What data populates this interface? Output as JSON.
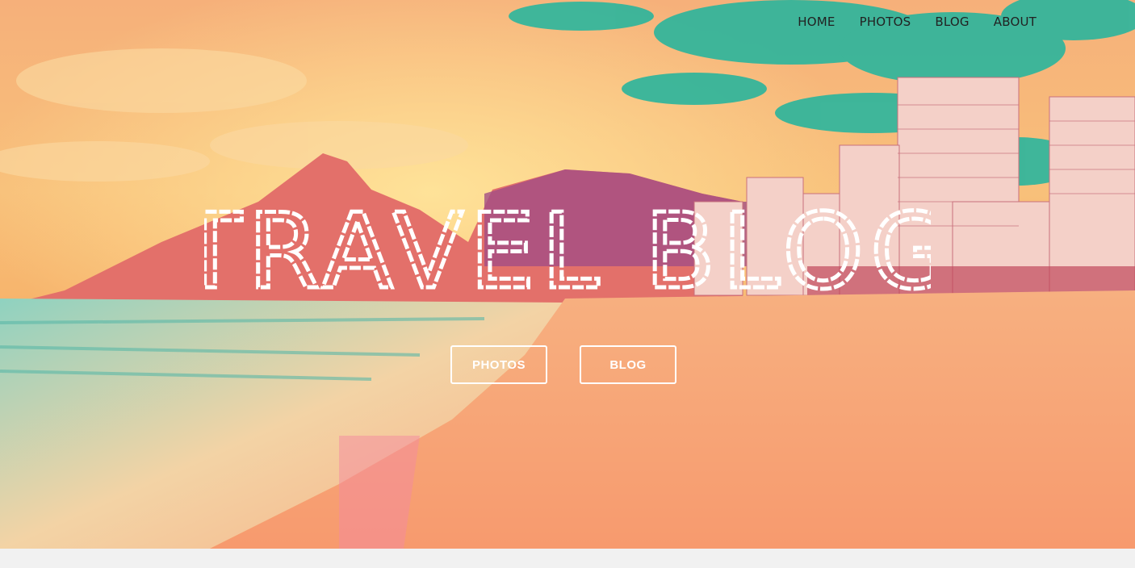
{
  "nav": {
    "items": [
      {
        "label": "HOME"
      },
      {
        "label": "PHOTOS"
      },
      {
        "label": "BLOG"
      },
      {
        "label": "ABOUT"
      }
    ]
  },
  "hero": {
    "title": "TRAVEL BLOG",
    "buttons": {
      "photos_label": "PHOTOS",
      "blog_label": "BLOG"
    }
  },
  "colors": {
    "nav_text": "#222222",
    "title": "#ffffff",
    "button_border": "#ffffff",
    "sky_top": "#f7b277",
    "sky_teal": "#2fb59c",
    "sand": "#f7a071",
    "mountain": "#e06a6a",
    "footer": "#f1f1f1"
  }
}
